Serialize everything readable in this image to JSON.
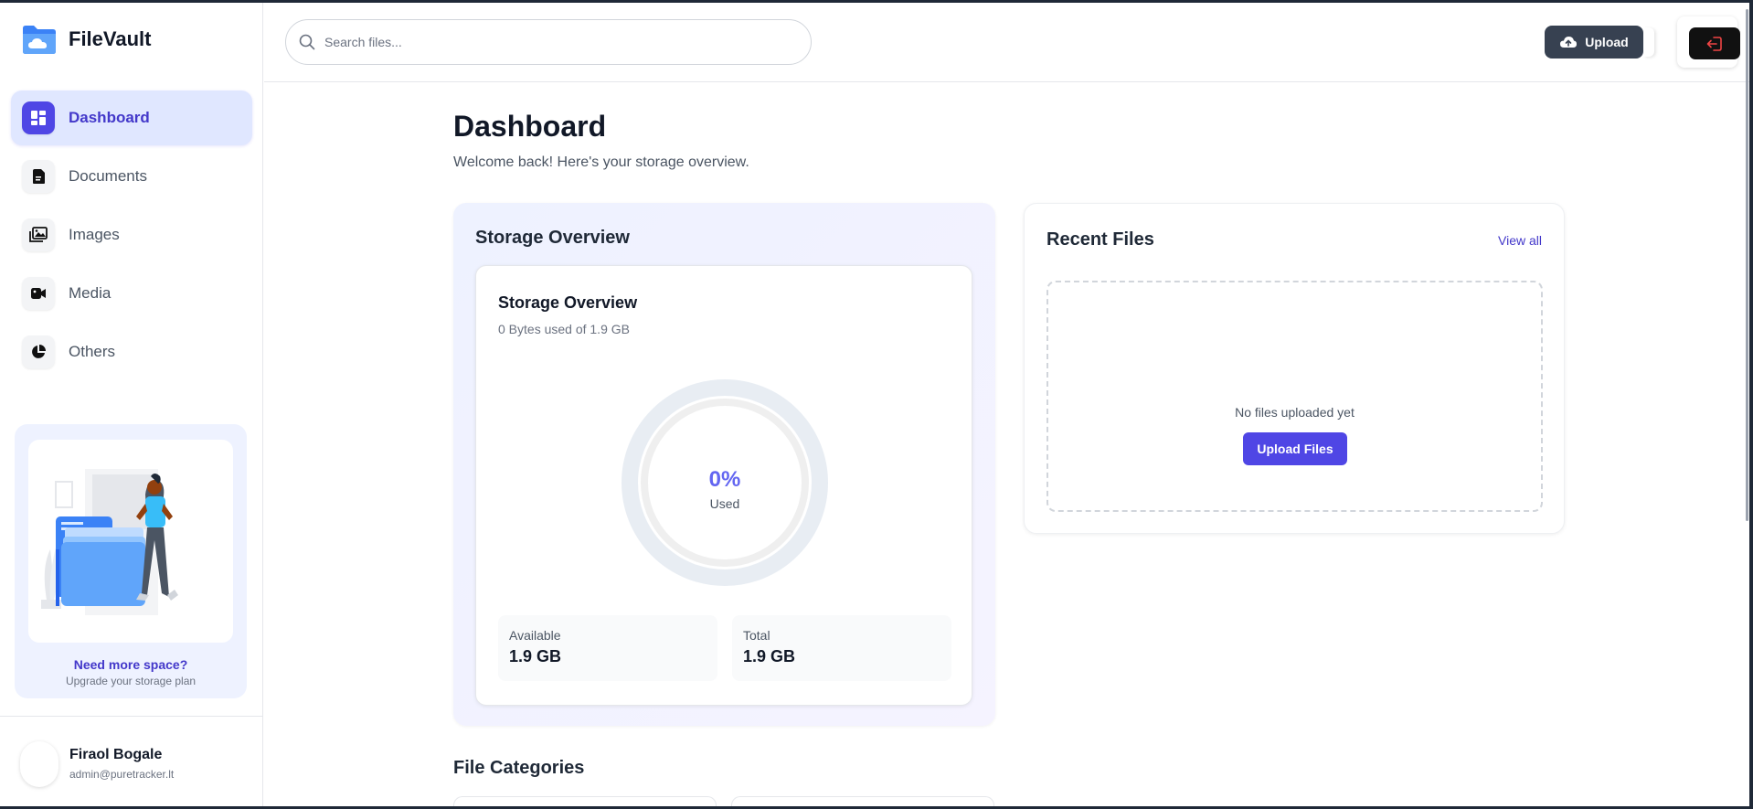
{
  "app": {
    "name": "FileVault"
  },
  "sidebar": {
    "items": [
      {
        "label": "Dashboard",
        "icon": "dashboard-icon",
        "active": true
      },
      {
        "label": "Documents",
        "icon": "document-icon",
        "active": false
      },
      {
        "label": "Images",
        "icon": "image-icon",
        "active": false
      },
      {
        "label": "Media",
        "icon": "video-icon",
        "active": false
      },
      {
        "label": "Others",
        "icon": "pie-chart-icon",
        "active": false
      }
    ],
    "promo": {
      "title": "Need more space?",
      "subtitle": "Upgrade your storage plan"
    },
    "user": {
      "name": "Firaol Bogale",
      "email": "admin@puretracker.lt"
    }
  },
  "header": {
    "search_placeholder": "Search files...",
    "upload_label": "Upload"
  },
  "main": {
    "title": "Dashboard",
    "subtitle": "Welcome back! Here's your storage overview.",
    "storage": {
      "section_title": "Storage Overview",
      "card_title": "Storage Overview",
      "usage_text": "0 Bytes used of 1.9 GB",
      "percent_text": "0%",
      "percent_value": 0,
      "percent_label": "Used",
      "available_label": "Available",
      "available_value": "1.9 GB",
      "total_label": "Total",
      "total_value": "1.9 GB"
    },
    "recent": {
      "title": "Recent Files",
      "view_all": "View all",
      "empty_text": "No files uploaded yet",
      "upload_button": "Upload Files"
    },
    "categories_title": "File Categories"
  },
  "colors": {
    "accent": "#4f46e5",
    "accent_light": "#e0e7ff",
    "dark_button": "#374151",
    "logout_icon": "#ef4444"
  }
}
